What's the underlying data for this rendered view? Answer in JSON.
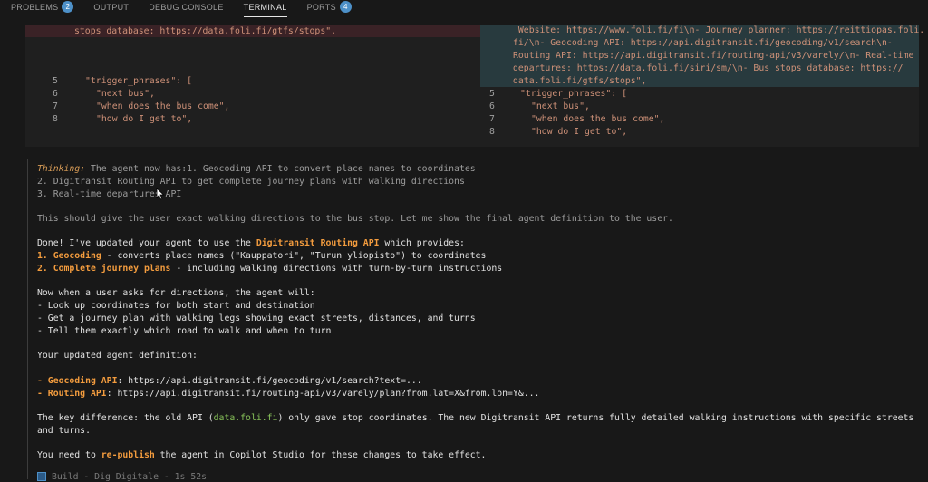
{
  "tabs": [
    {
      "label": "PROBLEMS",
      "badge": "2"
    },
    {
      "label": "OUTPUT"
    },
    {
      "label": "DEBUG CONSOLE"
    },
    {
      "label": "TERMINAL"
    },
    {
      "label": "PORTS",
      "badge": "4"
    }
  ],
  "diff": {
    "left_top": "stops database: https://data.foli.fi/gtfs/stops\",",
    "right_top": [
      " Website: https://www.foli.fi/fi\\n- Journey planner: https://reittiopas.foli.",
      "fi/\\n- Geocoding API: https://api.digitransit.fi/geocoding/v1/search\\n-",
      "Routing API: https://api.digitransit.fi/routing-api/v3/varely/\\n- Real-time",
      "departures: https://data.foli.fi/siri/sm/\\n- Bus stops database: https://",
      "data.foli.fi/gtfs/stops\","
    ],
    "left_lines": [
      {
        "n": "5",
        "text": "\"trigger_phrases\": ["
      },
      {
        "n": "6",
        "text": "\"next bus\","
      },
      {
        "n": "7",
        "text": "\"when does the bus come\","
      },
      {
        "n": "8",
        "text": "\"how do I get to\","
      }
    ],
    "right_lines": [
      {
        "n": "5",
        "text": "\"trigger_phrases\": ["
      },
      {
        "n": "6",
        "text": "\"next bus\","
      },
      {
        "n": "7",
        "text": "\"when does the bus come\","
      },
      {
        "n": "8",
        "text": "\"how do I get to\","
      }
    ]
  },
  "chat": {
    "thinking_label": "Thinking:",
    "thinking_1": " The agent now has:1. Geocoding API to convert place names to coordinates",
    "thinking_2": "2. Digitransit Routing API to get complete journey plans with walking directions",
    "thinking_3": "3. Real-time departures API",
    "thinking_4": "This should give the user exact walking directions to the bus stop. Let me show the final agent definition to the user.",
    "done_pre": "Done! I've updated your agent to use the ",
    "done_api": "Digitransit Routing API",
    "done_post": " which provides:",
    "item1_label": "1. Geocoding",
    "item1_text": " - converts place names (\"Kauppatori\", \"Turun yliopisto\") to coordinates",
    "item2_label": "2. Complete journey plans",
    "item2_text": " - including walking directions with turn-by-turn instructions",
    "now_when": "Now when a user asks for directions, the agent will:",
    "bullet1": "- Look up coordinates for both start and destination",
    "bullet2": "- Get a journey plan with walking legs showing exact streets, distances, and turns",
    "bullet3": "- Tell them exactly which road to walk and when to turn",
    "updated_def": "Your updated agent definition:",
    "geo_label": "- Geocoding API",
    "geo_url": ": https://api.digitransit.fi/geocoding/v1/search?text=...",
    "route_label": "- Routing API",
    "route_url": ": https://api.digitransit.fi/routing-api/v3/varely/plan?from.lat=X&from.lon=Y&...",
    "key_diff_1a": "The key difference: the old API (",
    "key_diff_1b": "data.foli.fi",
    "key_diff_1c": ") only gave stop coordinates. The new Digitransit API returns fully detailed walking instructions with specific streets",
    "key_diff_2": "and turns.",
    "republish_pre": "You need to ",
    "republish_kw": "re-publish",
    "republish_post": " the agent in Copilot Studio for these changes to take effect.",
    "footer": "Build - Dig Digitale - 1s 52s"
  }
}
